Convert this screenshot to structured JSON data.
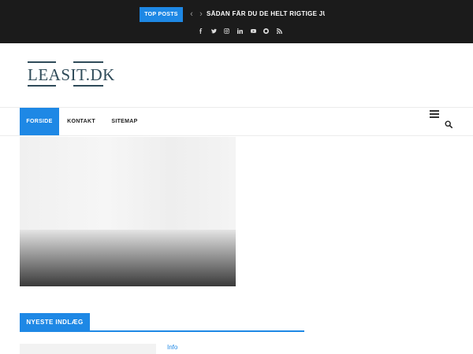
{
  "topbar": {
    "badge": "TOP POSTS",
    "prev_arrow": "‹",
    "next_arrow": "›",
    "ticker_text": "SÅDAN FÅR DU DE HELT RIGTIGE JULEGAVER",
    "social_icons": [
      "facebook-icon",
      "twitter-icon",
      "instagram-icon",
      "linkedin-icon",
      "youtube-icon",
      "circle-icon",
      "rss-icon"
    ]
  },
  "logo": {
    "text": "LEASIT.DK"
  },
  "nav": {
    "items": [
      {
        "label": "FORSIDE",
        "active": true
      },
      {
        "label": "KONTAKT",
        "active": false
      },
      {
        "label": "SITEMAP",
        "active": false
      }
    ]
  },
  "latest": {
    "heading": "NYESTE INDLÆG",
    "first_post_category": "Info"
  },
  "colors": {
    "accent": "#1e88e5",
    "topbar_bg": "#1b1b1b",
    "logo": "#2f4b59"
  }
}
